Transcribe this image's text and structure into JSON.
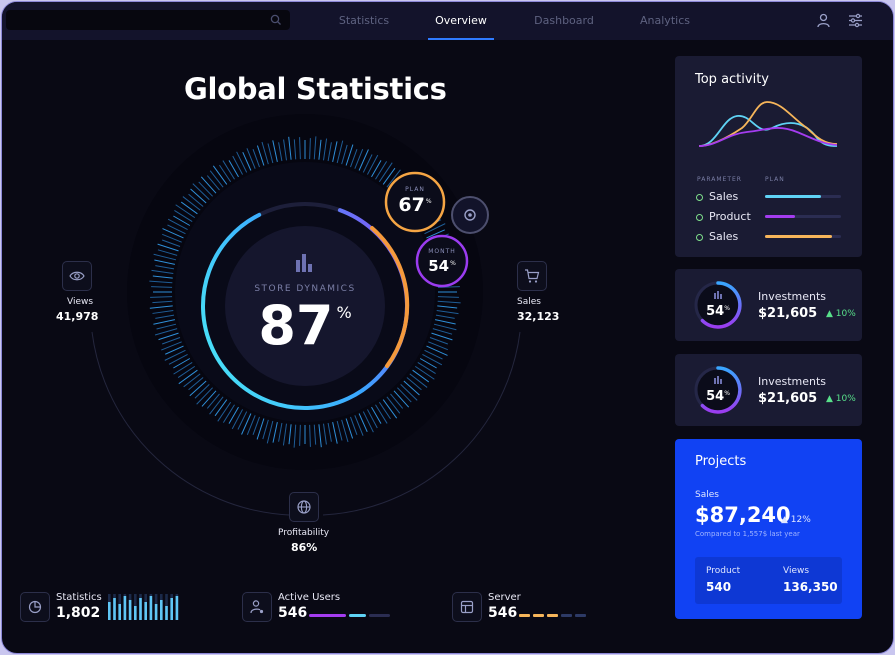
{
  "nav": {
    "tabs": [
      "Statistics",
      "Overview",
      "Dashboard",
      "Analytics"
    ],
    "active_tab": "Overview",
    "icons": [
      "search-icon",
      "user-icon",
      "settings-sliders-icon"
    ]
  },
  "main": {
    "title": "Global Statistics",
    "gauge": {
      "label": "STORE DYNAMICS",
      "value": "87",
      "unit": "%",
      "fraction": 0.87
    },
    "plan": {
      "label": "PLAN",
      "value": "67",
      "unit": "%"
    },
    "month": {
      "label": "MONTH",
      "value": "54",
      "unit": "%"
    },
    "views": {
      "label": "Views",
      "value": "41,978"
    },
    "sales": {
      "label": "Sales",
      "value": "32,123"
    },
    "profitability": {
      "label": "Profitability",
      "value": "86%"
    }
  },
  "bottom": {
    "statistics": {
      "label": "Statistics",
      "value": "1,802"
    },
    "active_users": {
      "label": "Active Users",
      "value": "546"
    },
    "server": {
      "label": "Server",
      "value": "546"
    }
  },
  "top_activity": {
    "title": "Top activity",
    "col_parameter": "PARAMETER",
    "col_plan": "PLAN",
    "rows": [
      {
        "label": "Sales",
        "progress": 0.74,
        "color": "#5fd3f5"
      },
      {
        "label": "Product",
        "progress": 0.4,
        "color": "#a43cf0"
      },
      {
        "label": "Sales",
        "progress": 0.88,
        "color": "#f6b55a"
      }
    ]
  },
  "investments": [
    {
      "ring_value": "54",
      "ring_unit": "%",
      "label": "Investments",
      "value": "$21,605",
      "change": "10%"
    },
    {
      "ring_value": "54",
      "ring_unit": "%",
      "label": "Investments",
      "value": "$21,605",
      "change": "10%"
    }
  ],
  "projects": {
    "title": "Projects",
    "sales_label": "Sales",
    "sales_value": "$87,240",
    "sales_change": "12%",
    "compare_text": "Compared to 1,557$ last year",
    "product_label": "Product",
    "product_value": "540",
    "views_label": "Views",
    "views_value": "136,350"
  },
  "colors": {
    "accent_blue": "#2f7bff",
    "cyan": "#5fd3f5",
    "orange": "#f59a3c",
    "purple": "#9b3cf0",
    "green": "#58e08a",
    "project_blue": "#1142f3"
  }
}
